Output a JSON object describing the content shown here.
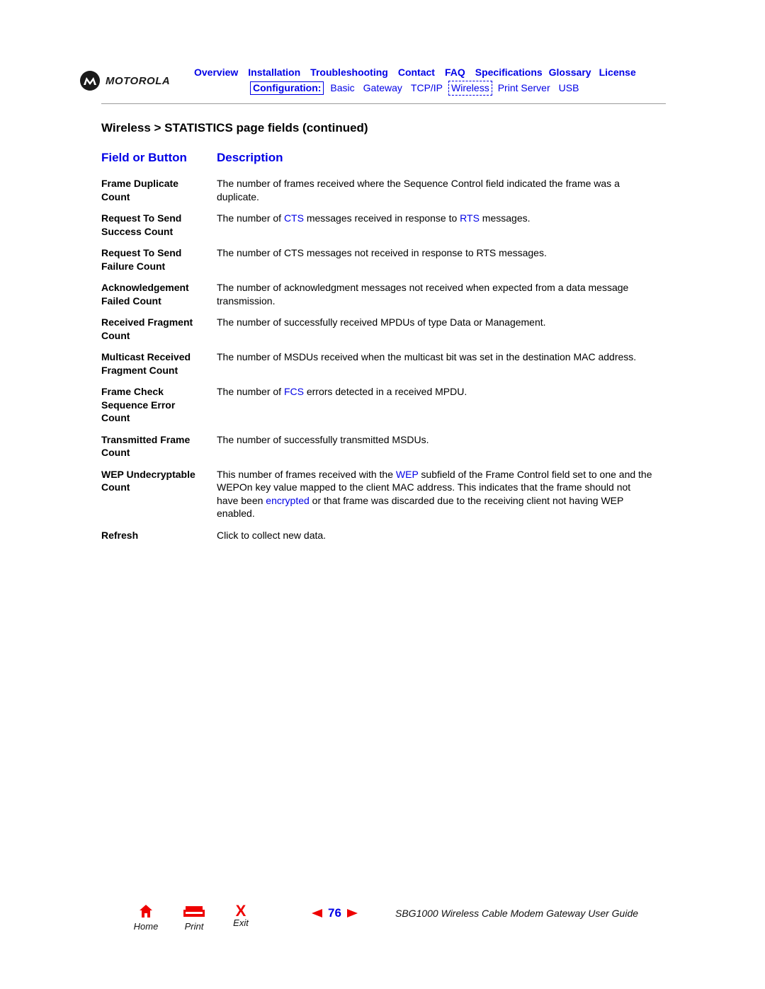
{
  "header": {
    "brand": "MOTOROLA",
    "top_nav": [
      "Overview",
      "Installation",
      "Troubleshooting",
      "Contact",
      "FAQ",
      "Specifications",
      "Glossary",
      "License"
    ],
    "config_label": "Configuration:",
    "sub_nav": [
      "Basic",
      "Gateway",
      "TCP/IP",
      "Wireless",
      "Print Server",
      "USB"
    ],
    "active_sub_nav": "Wireless"
  },
  "section_title": "Wireless > STATISTICS page fields (continued)",
  "columns": {
    "field": "Field or Button",
    "description": "Description"
  },
  "rows": [
    {
      "field": [
        "Frame Duplicate",
        "Count"
      ],
      "desc": [
        {
          "t": "The number of frames received where the Sequence Control field indicated the frame was a duplicate."
        }
      ]
    },
    {
      "field": [
        "Request To Send",
        "Success Count"
      ],
      "desc": [
        {
          "t": "The number of "
        },
        {
          "t": "CTS",
          "link": true
        },
        {
          "t": " messages received in response to "
        },
        {
          "t": "RTS",
          "link": true
        },
        {
          "t": " messages."
        }
      ]
    },
    {
      "field": [
        "Request To Send",
        "Failure Count"
      ],
      "desc": [
        {
          "t": "The number of CTS messages not received in response to RTS messages."
        }
      ]
    },
    {
      "field": [
        "Acknowledgement",
        "Failed Count"
      ],
      "desc": [
        {
          "t": "The number of acknowledgment messages not received when expected from a data message transmission."
        }
      ]
    },
    {
      "field": [
        "Received Fragment",
        "Count"
      ],
      "desc": [
        {
          "t": "The number of successfully received MPDUs of type Data or Management."
        }
      ]
    },
    {
      "field": [
        "Multicast Received",
        "Fragment Count"
      ],
      "desc": [
        {
          "t": "The number of MSDUs received when the multicast bit was set in the destination MAC address."
        }
      ]
    },
    {
      "field": [
        "Frame Check",
        "Sequence Error",
        "Count"
      ],
      "desc": [
        {
          "t": "The number of "
        },
        {
          "t": "FCS",
          "link": true
        },
        {
          "t": " errors detected in a received MPDU."
        }
      ]
    },
    {
      "field": [
        "Transmitted Frame",
        "Count"
      ],
      "desc": [
        {
          "t": "The number of successfully transmitted MSDUs."
        }
      ]
    },
    {
      "field": [
        "WEP Undecryptable",
        "Count"
      ],
      "desc": [
        {
          "t": "This number of frames received with the "
        },
        {
          "t": "WEP",
          "link": true
        },
        {
          "t": " subfield of the Frame Control field set to one and the WEPOn key value mapped to the client MAC address. This indicates that the frame should not have been "
        },
        {
          "t": "encrypted",
          "link": true
        },
        {
          "t": " or that frame was discarded due to the receiving client not having WEP enabled."
        }
      ]
    },
    {
      "field": [
        "Refresh"
      ],
      "desc": [
        {
          "t": "Click to collect new data."
        }
      ]
    }
  ],
  "footer": {
    "home_label": "Home",
    "print_label": "Print",
    "exit_label": "Exit",
    "exit_glyph": "X",
    "page_number": "76",
    "guide_title": "SBG1000 Wireless Cable Modem Gateway User Guide"
  },
  "colors": {
    "link": "#0000e6",
    "accent_red": "#ee0000",
    "rule": "#9a9a9a"
  }
}
